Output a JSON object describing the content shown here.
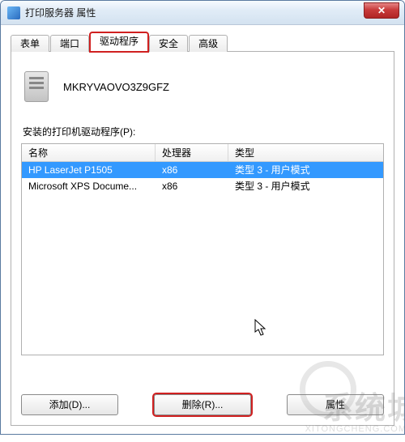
{
  "window": {
    "title": "打印服务器 属性",
    "close_glyph": "✕"
  },
  "tabs": [
    {
      "label": "表单"
    },
    {
      "label": "端口"
    },
    {
      "label": "驱动程序"
    },
    {
      "label": "安全"
    },
    {
      "label": "高级"
    }
  ],
  "server": {
    "name": "MKRYVAOVO3Z9GFZ"
  },
  "list_label": "安装的打印机驱动程序(P):",
  "columns": {
    "name": "名称",
    "processor": "处理器",
    "type": "类型"
  },
  "drivers": [
    {
      "name": "HP LaserJet P1505",
      "processor": "x86",
      "type": "类型 3 - 用户模式",
      "selected": true
    },
    {
      "name": "Microsoft XPS Docume...",
      "processor": "x86",
      "type": "类型 3 - 用户模式",
      "selected": false
    }
  ],
  "buttons": {
    "add": "添加(D)...",
    "remove": "删除(R)...",
    "properties": "属性"
  },
  "watermark": {
    "main": "系统城",
    "sub": "XITONGCHENG.COM"
  }
}
